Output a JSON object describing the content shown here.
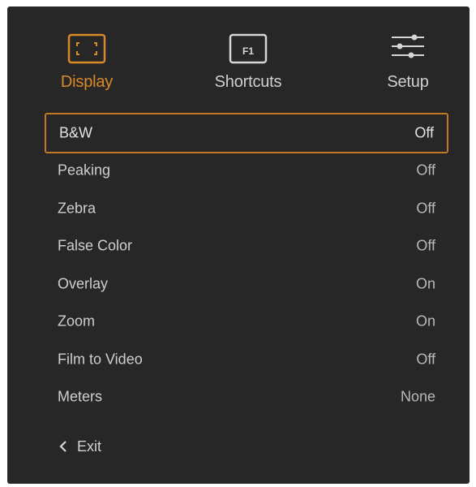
{
  "tabs": [
    {
      "label": "Display",
      "icon": "display-frame-icon",
      "active": true
    },
    {
      "label": "Shortcuts",
      "icon": "f1-key-icon",
      "active": false
    },
    {
      "label": "Setup",
      "icon": "sliders-icon",
      "active": false
    }
  ],
  "f1_key_text": "F1",
  "settings": [
    {
      "name": "B&W",
      "value": "Off"
    },
    {
      "name": "Peaking",
      "value": "Off"
    },
    {
      "name": "Zebra",
      "value": "Off"
    },
    {
      "name": "False Color",
      "value": "Off"
    },
    {
      "name": "Overlay",
      "value": "On"
    },
    {
      "name": "Zoom",
      "value": "On"
    },
    {
      "name": "Film to Video",
      "value": "Off"
    },
    {
      "name": "Meters",
      "value": "None"
    }
  ],
  "exit_label": "Exit",
  "colors": {
    "accent": "#d98a2b",
    "panel_bg": "#272727",
    "text": "#cfcfcf"
  }
}
